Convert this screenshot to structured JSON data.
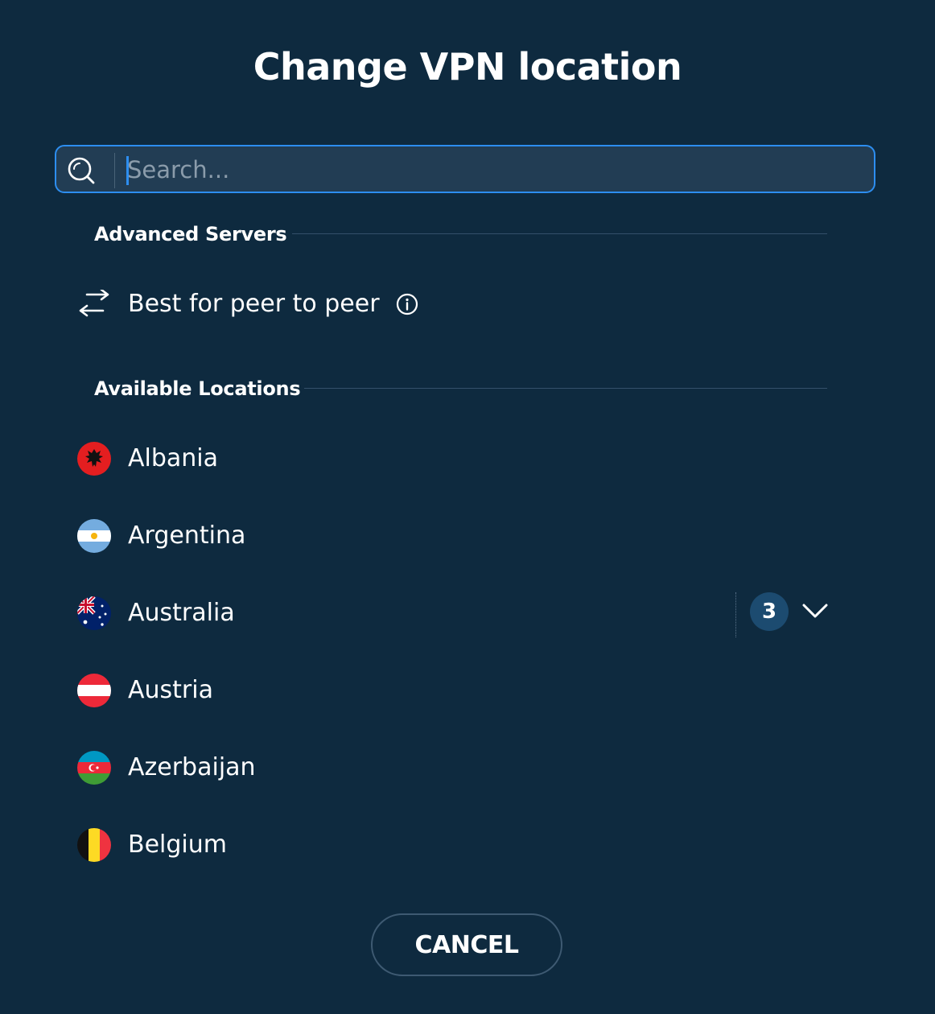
{
  "dialog": {
    "title": "Change VPN location"
  },
  "search": {
    "placeholder": "Search...",
    "value": ""
  },
  "advanced": {
    "header": "Advanced Servers",
    "items": [
      {
        "label": "Best for peer to peer",
        "icon": "peer-to-peer-arrows-icon",
        "info_icon": "info-icon"
      }
    ]
  },
  "locations": {
    "header": "Available Locations",
    "items": [
      {
        "name": "Albania",
        "flag": "albania-flag-icon"
      },
      {
        "name": "Argentina",
        "flag": "argentina-flag-icon"
      },
      {
        "name": "Australia",
        "flag": "australia-flag-icon",
        "server_count": "3",
        "expand_icon": "chevron-down-icon"
      },
      {
        "name": "Austria",
        "flag": "austria-flag-icon"
      },
      {
        "name": "Azerbaijan",
        "flag": "azerbaijan-flag-icon"
      },
      {
        "name": "Belgium",
        "flag": "belgium-flag-icon"
      }
    ]
  },
  "footer": {
    "cancel_label": "CANCEL"
  },
  "colors": {
    "background": "#0e2a3f",
    "search_border": "#2d8ef0",
    "search_fill": "#223d54",
    "badge_fill": "#1c4b70"
  }
}
